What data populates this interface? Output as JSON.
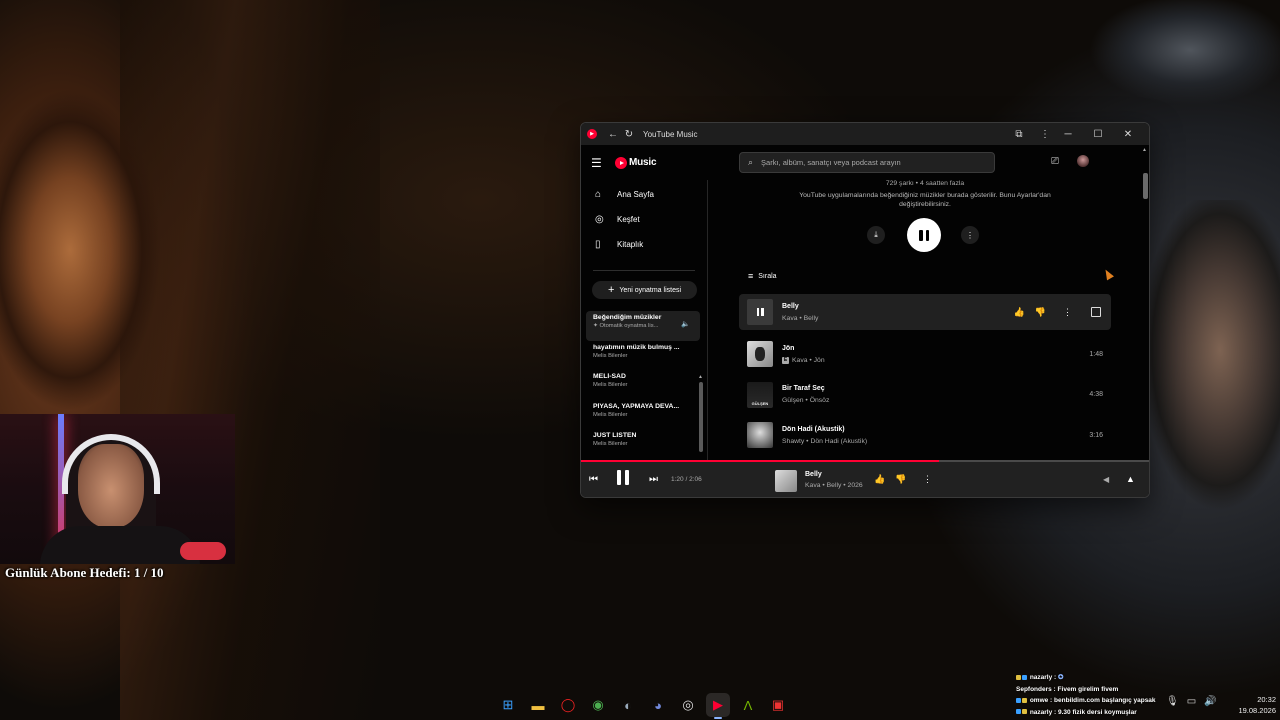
{
  "desktop": {
    "sub_goal": "Günlük Abone Hedefi: 1 / 10"
  },
  "window": {
    "title": "YouTube Music"
  },
  "topbar": {
    "logo_text": "Music",
    "search_placeholder": "Şarkı, albüm, sanatçı veya podcast arayın"
  },
  "sidebar": {
    "nav": [
      {
        "label": "Ana Sayfa",
        "icon": "home-icon"
      },
      {
        "label": "Keşfet",
        "icon": "explore-icon"
      },
      {
        "label": "Kitaplık",
        "icon": "library-icon"
      }
    ],
    "new_playlist": "Yeni oynatma listesi",
    "playlists": [
      {
        "title": "Beğendiğim müzikler",
        "sub": "Otomatik oynatma lis..."
      },
      {
        "title": "hayatımın müzik bulmuş ...",
        "sub": "Melis Bilenler"
      },
      {
        "title": "MELİ-SAD",
        "sub": "Melis Bilenler"
      },
      {
        "title": "PİYASA, YAPMAYA DEVA...",
        "sub": "Melis Bilenler"
      },
      {
        "title": "JUST LISTEN",
        "sub": "Melis Bilenler"
      }
    ]
  },
  "main": {
    "count": "729 şarkı • 4 saatten fazla",
    "description": "YouTube uygulamalarında beğendiğiniz müzikler burada gösterilir. Bunu Ayarlar'dan değiştirebilirsiniz.",
    "sort_label": "Sırala",
    "tracks": [
      {
        "title": "Belly",
        "sub": "Kava • Belly",
        "duration": "",
        "explicit": false
      },
      {
        "title": "Jön",
        "sub": "Kava • Jön",
        "duration": "1:48",
        "explicit": true
      },
      {
        "title": "Bir Taraf Seç",
        "sub": "Gülşen • Önsöz",
        "duration": "4:38",
        "explicit": false
      },
      {
        "title": "Dön Hadi (Akustik)",
        "sub": "Shawty • Dön Hadi (Akustik)",
        "duration": "3:16",
        "explicit": false
      }
    ]
  },
  "player": {
    "time": "1:20 / 2:06",
    "progress": 0.63,
    "title": "Belly",
    "sub": "Kava • Belly • 2026"
  },
  "chat": [
    {
      "user": "nazarly :",
      "text": ""
    },
    {
      "user": "Sepfonders :",
      "text": "Fivem girelim fivem"
    },
    {
      "user": "omwe :",
      "text": "benbildim.com başlangıç yapsak"
    },
    {
      "user": "nazarly :",
      "text": "9.30 fizik dersi koymuşlar"
    }
  ],
  "clock": {
    "time": "20:32",
    "date": "19.08.2026"
  },
  "colors": {
    "accent": "#ff0033",
    "bg": "#030303",
    "surface": "#212121"
  }
}
